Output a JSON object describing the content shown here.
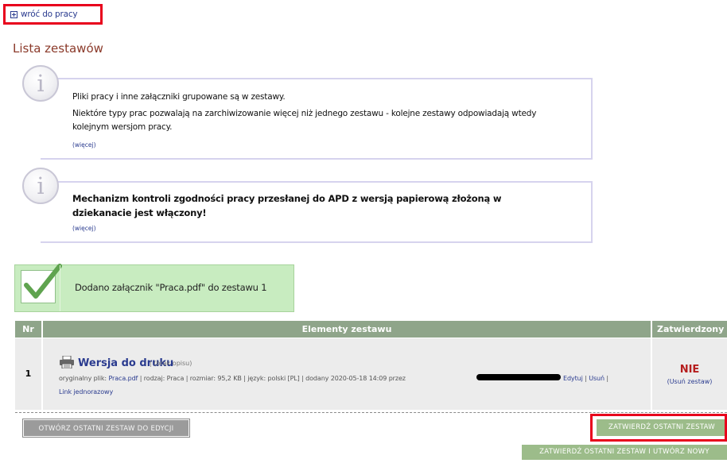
{
  "nav": {
    "back_label": "wróć do pracy"
  },
  "page": {
    "section_title": "Lista zestawów"
  },
  "info1": {
    "line1": "Pliki pracy i inne załączniki grupowane są w zestawy.",
    "line2": "Niektóre typy prac pozwalają na zarchiwizowanie więcej niż jednego zestawu - kolejne zestawy odpowiadają wtedy kolejnym wersjom pracy.",
    "more": "(więcej)"
  },
  "info2": {
    "text": "Mechanizm kontroli zgodności pracy przesłanej do APD z wersją papierową złożoną w dziekanacie jest włączony!",
    "more": "(więcej)"
  },
  "success": {
    "message": "Dodano załącznik \"Praca.pdf\" do zestawu 1"
  },
  "table": {
    "headers": [
      "Nr",
      "Elementy zestawu",
      "Zatwierdzony"
    ],
    "rows": [
      {
        "nr": "1",
        "title": "Wersja do druku",
        "desc": "| (brak opisu)",
        "meta_prefix": "oryginalny plik:",
        "file_link": "Praca.pdf",
        "meta_mid": "| rodzaj: Praca | rozmiar: 95,2 KB | język: polski [PL] | dodany 2020-05-18 14:09 przez",
        "edit_link": "Edytuj",
        "delete_link": "Usuń",
        "onetime_link": "Link jednorazowy",
        "approved": "NIE",
        "remove_set": "(Usuń zestaw)"
      }
    ]
  },
  "buttons": {
    "open_last": "OTWÓRZ OSTATNI ZESTAW DO EDYCJI",
    "approve_last": "ZATWIERDŹ OSTATNI ZESTAW",
    "approve_new": "ZATWIERDŹ OSTATNI ZESTAW I UTWÓRZ NOWY"
  },
  "icons": [
    "plus-box-icon",
    "info-icon",
    "checkmark-icon",
    "printer-icon"
  ],
  "colors": {
    "link": "#2a3b8f",
    "title": "#8b3a2a",
    "highlight": "#e8001c",
    "header": "#8fa58a",
    "success": "#c8ecc0",
    "no": "#b51d1d"
  }
}
